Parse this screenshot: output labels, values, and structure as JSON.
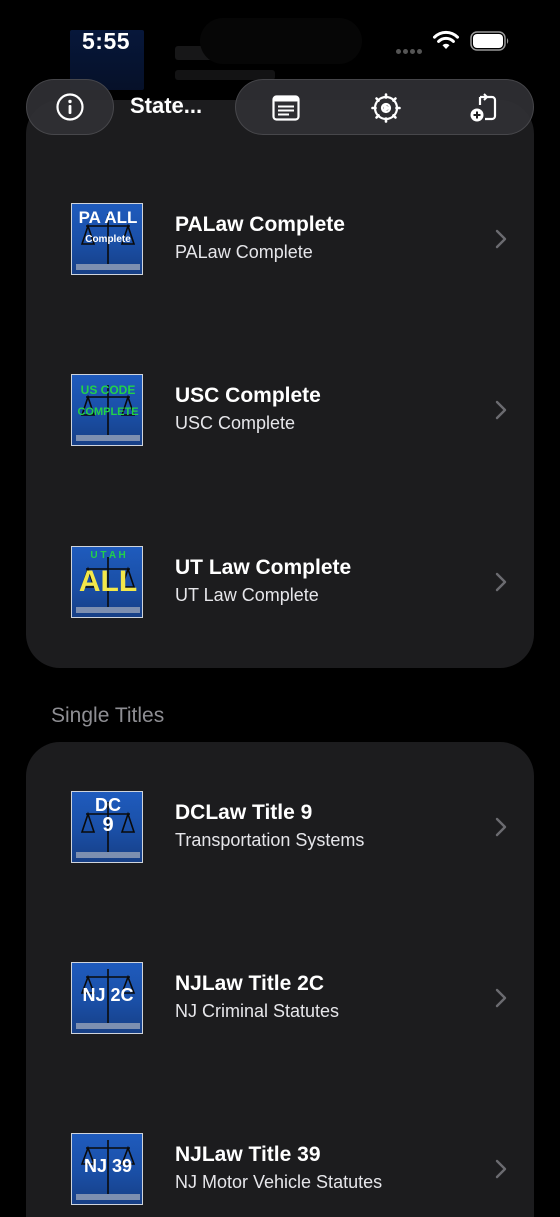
{
  "status_bar": {
    "time": "5:55"
  },
  "toolbar": {
    "title": "State...",
    "info_icon": "info-icon",
    "document_icon": "document-icon",
    "settings_icon": "settings-icon",
    "add_icon": "add-document-icon"
  },
  "sections": [
    {
      "header": "",
      "items": [
        {
          "title": "PALaw Complete",
          "subtitle": "PALaw Complete",
          "thumb_line1": "PA ALL",
          "thumb_line2": "Complete"
        },
        {
          "title": "USC Complete",
          "subtitle": "USC Complete",
          "thumb_line1": "US CODE",
          "thumb_line2": "COMPLETE"
        },
        {
          "title": "UT Law Complete",
          "subtitle": "UT Law Complete",
          "thumb_line1": "U T A H",
          "thumb_line2": "ALL"
        }
      ]
    },
    {
      "header": "Single Titles",
      "items": [
        {
          "title": "DCLaw Title 9",
          "subtitle": "Transportation Systems",
          "thumb_line1": "DC",
          "thumb_line2": "9"
        },
        {
          "title": "NJLaw Title 2C",
          "subtitle": "NJ Criminal Statutes",
          "thumb_line1": "NJ 2C"
        },
        {
          "title": "NJLaw Title 39",
          "subtitle": "NJ Motor Vehicle Statutes",
          "thumb_line1": "NJ 39"
        }
      ]
    }
  ],
  "colors": {
    "background": "#000000",
    "card": "#1c1c1e",
    "secondary_text": "#8e8e93",
    "thumb_blue": "#1f5bbd",
    "thumb_green": "#22d14a",
    "thumb_yellow": "#f3e84a"
  }
}
